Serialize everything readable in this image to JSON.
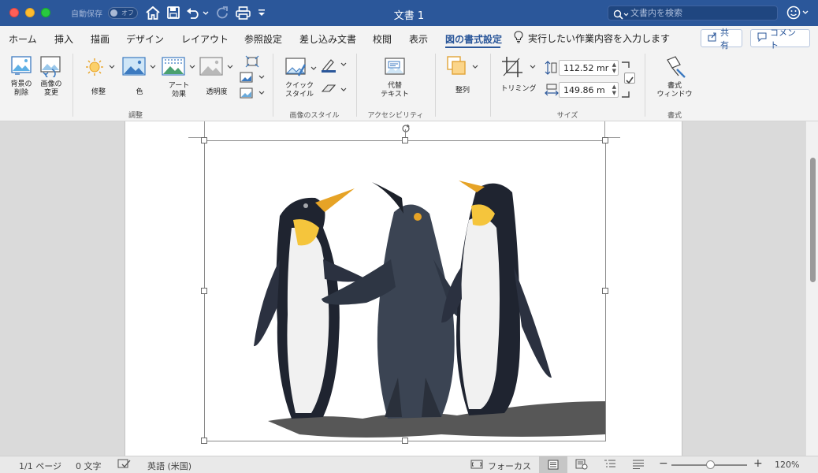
{
  "window": {
    "title": "文書 1",
    "autosave_label": "自動保存",
    "autosave_state": "オフ"
  },
  "search": {
    "placeholder": "文書内を検索"
  },
  "tabs": [
    {
      "label": "ホーム"
    },
    {
      "label": "挿入"
    },
    {
      "label": "描画"
    },
    {
      "label": "デザイン"
    },
    {
      "label": "レイアウト"
    },
    {
      "label": "参照設定"
    },
    {
      "label": "差し込み文書"
    },
    {
      "label": "校閲"
    },
    {
      "label": "表示"
    },
    {
      "label": "図の書式設定",
      "active": true
    }
  ],
  "tell_me": "実行したい作業内容を入力します",
  "share_button": "共有",
  "comment_button": "コメント",
  "ribbon": {
    "adjust": {
      "group_label": "調整",
      "remove_bg": [
        "背景の",
        "削除"
      ],
      "change_picture": [
        "画像の",
        "変更"
      ],
      "corrections": "修整",
      "color": "色",
      "artistic": [
        "アート",
        "効果"
      ],
      "transparency": "透明度"
    },
    "styles": {
      "group_label": "画像のスタイル",
      "quick_styles": [
        "クイック",
        "スタイル"
      ]
    },
    "accessibility": {
      "group_label": "アクセシビリティ",
      "alt_text": [
        "代替",
        "テキスト"
      ]
    },
    "arrange": {
      "label": "整列"
    },
    "size": {
      "group_label": "サイズ",
      "crop": "トリミング",
      "height": "112.52 mr",
      "width": "149.86 m"
    },
    "format": {
      "group_label": "書式",
      "format_pane": [
        "書式",
        "ウィンドウ"
      ]
    }
  },
  "statusbar": {
    "page": "1/1 ページ",
    "words": "0 文字",
    "language": "英語 (米国)",
    "focus": "フォーカス",
    "zoom": "120%",
    "zoom_level": 0.52
  },
  "colors": {
    "title_bar": "#2b579a",
    "accent": "#2b579a"
  }
}
